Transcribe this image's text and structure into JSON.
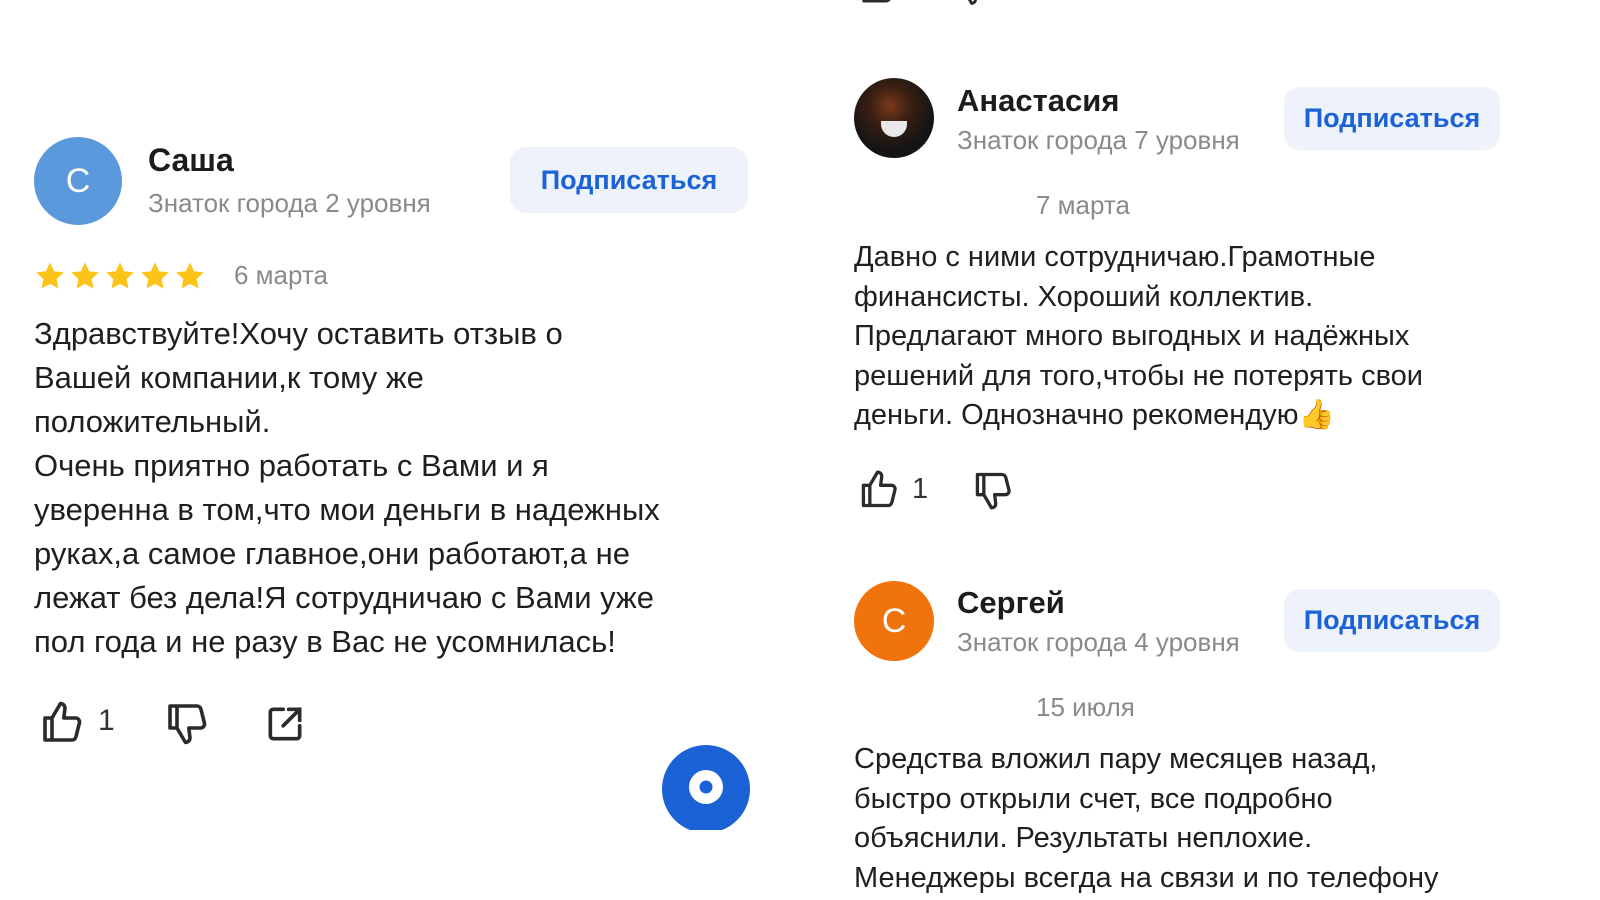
{
  "colors": {
    "accent": "#1a62d6",
    "subscribe_bg": "#eef3fb",
    "star": "#fcc419",
    "avatar_sasha": "#5a99dc",
    "avatar_sergey": "#f0730c",
    "muted": "#8a8a8a"
  },
  "left_review": {
    "avatar_letter": "С",
    "name": "Саша",
    "level": "Знаток города 2 уровня",
    "subscribe_label": "Подписаться",
    "rating": 5,
    "date": "6 марта",
    "text": "Здравствуйте!Хочу оставить отзыв о\nВашей компании,к тому же\nположительный.\nОчень приятно работать с Вами и я\nуверенна в том,что мои деньги в надежных\nруках,а самое главное,они работают,а не\nлежат без дела!Я сотрудничаю с Вами уже\nпол года и не разу в Вас не усомнилась!",
    "likes": "1",
    "icons": [
      "thumb-up-icon",
      "thumb-down-icon",
      "share-icon",
      "map-pin-icon"
    ]
  },
  "right_reviews": [
    {
      "name": "Анастасия",
      "level": "Знаток города 7 уровня",
      "subscribe_label": "Подписаться",
      "date": "7 марта",
      "text": "Давно с ними сотрудничаю.Грамотные\nфинансисты. Хороший коллектив.\nПредлагают много выгодных и надёжных\nрешений для того,чтобы не потерять свои\nденьги. Однозначно рекомендую",
      "emoji": "👍",
      "likes": "1"
    },
    {
      "avatar_letter": "С",
      "name": "Сергей",
      "level": "Знаток города 4 уровня",
      "subscribe_label": "Подписаться",
      "date": "15 июля",
      "text": "Средства вложил пару месяцев назад,\nбыстро открыли счет, все подробно\nобъяснили. Результаты неплохие.\nМенеджеры всегда на связи и по телефону"
    }
  ]
}
